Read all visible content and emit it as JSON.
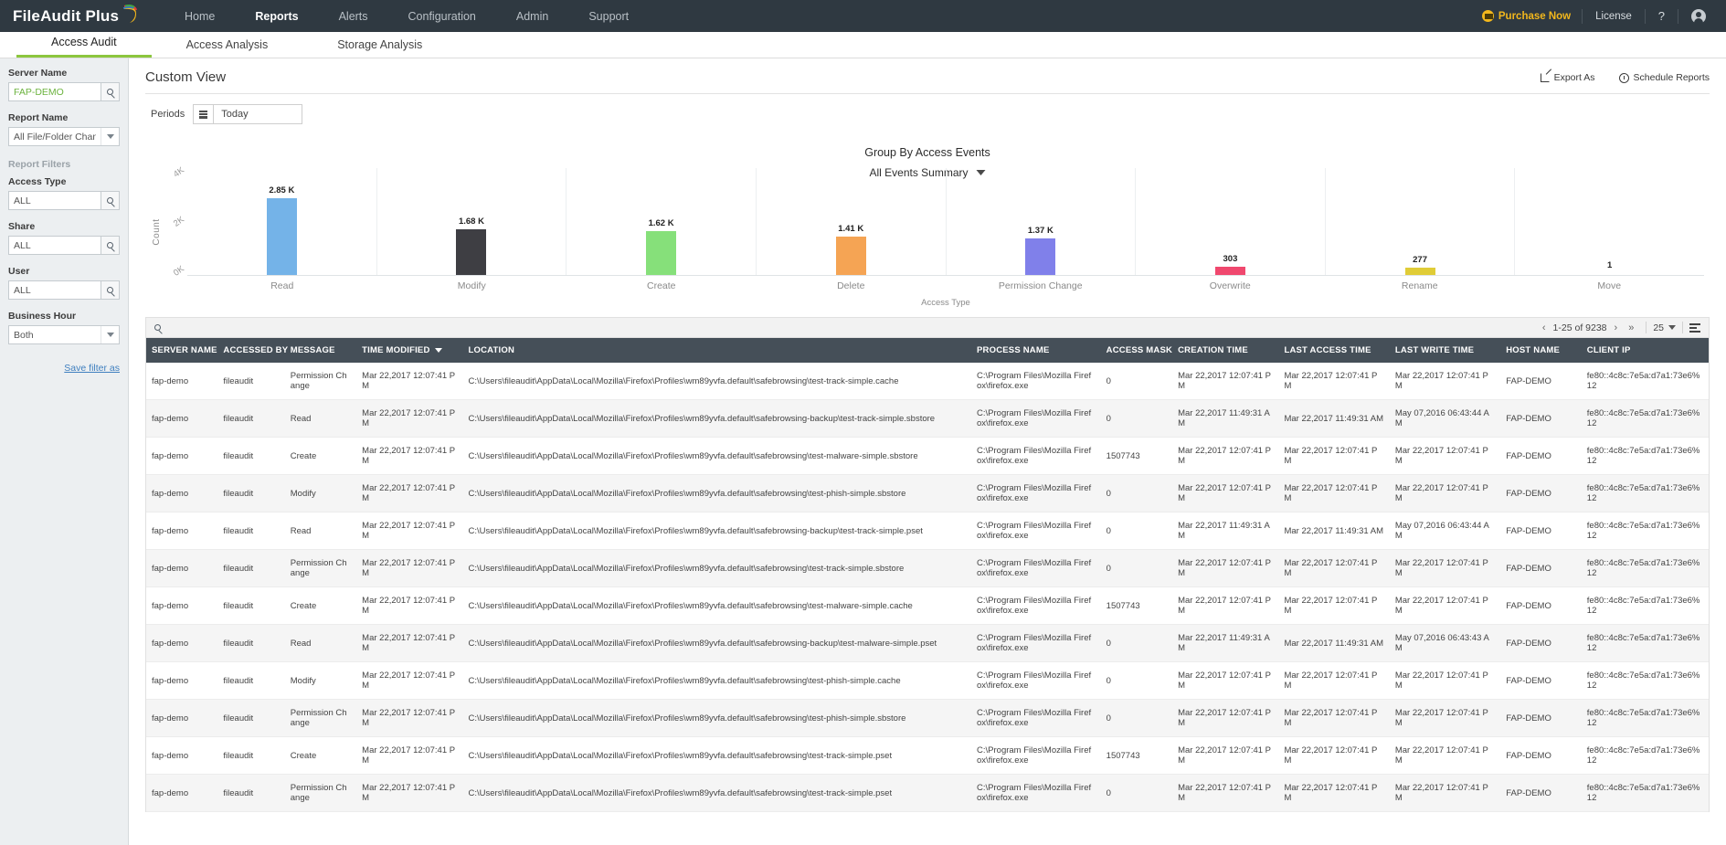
{
  "header": {
    "brand": "FileAudit Plus",
    "nav": [
      {
        "label": "Home",
        "active": false
      },
      {
        "label": "Reports",
        "active": true
      },
      {
        "label": "Alerts",
        "active": false
      },
      {
        "label": "Configuration",
        "active": false
      },
      {
        "label": "Admin",
        "active": false
      },
      {
        "label": "Support",
        "active": false
      }
    ],
    "purchase_label": "Purchase Now",
    "license_label": "License",
    "help_label": "?"
  },
  "subnav": [
    {
      "label": "Access Audit",
      "active": true
    },
    {
      "label": "Access Analysis",
      "active": false
    },
    {
      "label": "Storage Analysis",
      "active": false
    }
  ],
  "sidebar": {
    "server_name_label": "Server Name",
    "server_name_value": "FAP-DEMO",
    "report_name_label": "Report Name",
    "report_name_value": "All File/Folder Changes",
    "report_filters_label": "Report Filters",
    "access_type_label": "Access Type",
    "access_type_value": "ALL",
    "share_label": "Share",
    "share_value": "ALL",
    "user_label": "User",
    "user_value": "ALL",
    "business_hour_label": "Business Hour",
    "business_hour_value": "Both",
    "save_filter_label": "Save filter as"
  },
  "main": {
    "page_title": "Custom View",
    "export_label": "Export As",
    "schedule_label": "Schedule Reports",
    "periods_label": "Periods",
    "periods_value": "Today",
    "summary_label": "All Events Summary"
  },
  "chart_data": {
    "type": "bar",
    "title": "Group By Access Events",
    "xlabel": "Access Type",
    "ylabel": "Count",
    "ylim": [
      0,
      4000
    ],
    "ytick_labels": [
      "0K",
      "2K",
      "4K"
    ],
    "ytick_values": [
      0,
      2000,
      4000
    ],
    "grid": false,
    "legend": "none",
    "categories": [
      "Read",
      "Modify",
      "Create",
      "Delete",
      "Permission Change",
      "Overwrite",
      "Rename",
      "Move"
    ],
    "values": [
      2850,
      1680,
      1620,
      1410,
      1370,
      303,
      277,
      1
    ],
    "value_labels": [
      "2.85 K",
      "1.68 K",
      "1.62 K",
      "1.41 K",
      "1.37 K",
      "303",
      "277",
      "1"
    ],
    "colors": [
      "#74b3e8",
      "#3e3e43",
      "#86e07a",
      "#f5a454",
      "#8080ea",
      "#f0486e",
      "#e0cc37",
      "#ffffff"
    ]
  },
  "table": {
    "search_placeholder": "",
    "pager_text": "1-25 of 9238",
    "page_size": "25",
    "columns": [
      "SERVER NAME",
      "ACCESSED BY",
      "MESSAGE",
      "TIME MODIFIED",
      "LOCATION",
      "PROCESS NAME",
      "ACCESS MASK",
      "CREATION TIME",
      "LAST ACCESS TIME",
      "LAST WRITE TIME",
      "HOST NAME",
      "CLIENT IP"
    ],
    "sorted_column": "TIME MODIFIED",
    "rows": [
      {
        "server": "fap-demo",
        "accessed_by": "fileaudit",
        "message": "Permission Change",
        "time_modified": "Mar 22,2017 12:07:41 PM",
        "location": "C:\\Users\\fileaudit\\AppData\\Local\\Mozilla\\Firefox\\Profiles\\wm89yvfa.default\\safebrowsing\\test-track-simple.cache",
        "process": "C:\\Program Files\\Mozilla Firefox\\firefox.exe",
        "mask": "0",
        "creation": "Mar 22,2017 12:07:41 PM",
        "last_access": "Mar 22,2017 12:07:41 PM",
        "last_write": "Mar 22,2017 12:07:41 PM",
        "host": "FAP-DEMO",
        "client_ip": "fe80::4c8c:7e5a:d7a1:73e6%12"
      },
      {
        "server": "fap-demo",
        "accessed_by": "fileaudit",
        "message": "Read",
        "time_modified": "Mar 22,2017 12:07:41 PM",
        "location": "C:\\Users\\fileaudit\\AppData\\Local\\Mozilla\\Firefox\\Profiles\\wm89yvfa.default\\safebrowsing-backup\\test-track-simple.sbstore",
        "process": "C:\\Program Files\\Mozilla Firefox\\firefox.exe",
        "mask": "0",
        "creation": "Mar 22,2017 11:49:31 AM",
        "last_access": "Mar 22,2017 11:49:31 AM",
        "last_write": "May 07,2016 06:43:44 AM",
        "host": "FAP-DEMO",
        "client_ip": "fe80::4c8c:7e5a:d7a1:73e6%12"
      },
      {
        "server": "fap-demo",
        "accessed_by": "fileaudit",
        "message": "Create",
        "time_modified": "Mar 22,2017 12:07:41 PM",
        "location": "C:\\Users\\fileaudit\\AppData\\Local\\Mozilla\\Firefox\\Profiles\\wm89yvfa.default\\safebrowsing\\test-malware-simple.sbstore",
        "process": "C:\\Program Files\\Mozilla Firefox\\firefox.exe",
        "mask": "1507743",
        "creation": "Mar 22,2017 12:07:41 PM",
        "last_access": "Mar 22,2017 12:07:41 PM",
        "last_write": "Mar 22,2017 12:07:41 PM",
        "host": "FAP-DEMO",
        "client_ip": "fe80::4c8c:7e5a:d7a1:73e6%12"
      },
      {
        "server": "fap-demo",
        "accessed_by": "fileaudit",
        "message": "Modify",
        "time_modified": "Mar 22,2017 12:07:41 PM",
        "location": "C:\\Users\\fileaudit\\AppData\\Local\\Mozilla\\Firefox\\Profiles\\wm89yvfa.default\\safebrowsing\\test-phish-simple.sbstore",
        "process": "C:\\Program Files\\Mozilla Firefox\\firefox.exe",
        "mask": "0",
        "creation": "Mar 22,2017 12:07:41 PM",
        "last_access": "Mar 22,2017 12:07:41 PM",
        "last_write": "Mar 22,2017 12:07:41 PM",
        "host": "FAP-DEMO",
        "client_ip": "fe80::4c8c:7e5a:d7a1:73e6%12"
      },
      {
        "server": "fap-demo",
        "accessed_by": "fileaudit",
        "message": "Read",
        "time_modified": "Mar 22,2017 12:07:41 PM",
        "location": "C:\\Users\\fileaudit\\AppData\\Local\\Mozilla\\Firefox\\Profiles\\wm89yvfa.default\\safebrowsing-backup\\test-track-simple.pset",
        "process": "C:\\Program Files\\Mozilla Firefox\\firefox.exe",
        "mask": "0",
        "creation": "Mar 22,2017 11:49:31 AM",
        "last_access": "Mar 22,2017 11:49:31 AM",
        "last_write": "May 07,2016 06:43:44 AM",
        "host": "FAP-DEMO",
        "client_ip": "fe80::4c8c:7e5a:d7a1:73e6%12"
      },
      {
        "server": "fap-demo",
        "accessed_by": "fileaudit",
        "message": "Permission Change",
        "time_modified": "Mar 22,2017 12:07:41 PM",
        "location": "C:\\Users\\fileaudit\\AppData\\Local\\Mozilla\\Firefox\\Profiles\\wm89yvfa.default\\safebrowsing\\test-track-simple.sbstore",
        "process": "C:\\Program Files\\Mozilla Firefox\\firefox.exe",
        "mask": "0",
        "creation": "Mar 22,2017 12:07:41 PM",
        "last_access": "Mar 22,2017 12:07:41 PM",
        "last_write": "Mar 22,2017 12:07:41 PM",
        "host": "FAP-DEMO",
        "client_ip": "fe80::4c8c:7e5a:d7a1:73e6%12"
      },
      {
        "server": "fap-demo",
        "accessed_by": "fileaudit",
        "message": "Create",
        "time_modified": "Mar 22,2017 12:07:41 PM",
        "location": "C:\\Users\\fileaudit\\AppData\\Local\\Mozilla\\Firefox\\Profiles\\wm89yvfa.default\\safebrowsing\\test-malware-simple.cache",
        "process": "C:\\Program Files\\Mozilla Firefox\\firefox.exe",
        "mask": "1507743",
        "creation": "Mar 22,2017 12:07:41 PM",
        "last_access": "Mar 22,2017 12:07:41 PM",
        "last_write": "Mar 22,2017 12:07:41 PM",
        "host": "FAP-DEMO",
        "client_ip": "fe80::4c8c:7e5a:d7a1:73e6%12"
      },
      {
        "server": "fap-demo",
        "accessed_by": "fileaudit",
        "message": "Read",
        "time_modified": "Mar 22,2017 12:07:41 PM",
        "location": "C:\\Users\\fileaudit\\AppData\\Local\\Mozilla\\Firefox\\Profiles\\wm89yvfa.default\\safebrowsing-backup\\test-malware-simple.pset",
        "process": "C:\\Program Files\\Mozilla Firefox\\firefox.exe",
        "mask": "0",
        "creation": "Mar 22,2017 11:49:31 AM",
        "last_access": "Mar 22,2017 11:49:31 AM",
        "last_write": "May 07,2016 06:43:43 AM",
        "host": "FAP-DEMO",
        "client_ip": "fe80::4c8c:7e5a:d7a1:73e6%12"
      },
      {
        "server": "fap-demo",
        "accessed_by": "fileaudit",
        "message": "Modify",
        "time_modified": "Mar 22,2017 12:07:41 PM",
        "location": "C:\\Users\\fileaudit\\AppData\\Local\\Mozilla\\Firefox\\Profiles\\wm89yvfa.default\\safebrowsing\\test-phish-simple.cache",
        "process": "C:\\Program Files\\Mozilla Firefox\\firefox.exe",
        "mask": "0",
        "creation": "Mar 22,2017 12:07:41 PM",
        "last_access": "Mar 22,2017 12:07:41 PM",
        "last_write": "Mar 22,2017 12:07:41 PM",
        "host": "FAP-DEMO",
        "client_ip": "fe80::4c8c:7e5a:d7a1:73e6%12"
      },
      {
        "server": "fap-demo",
        "accessed_by": "fileaudit",
        "message": "Permission Change",
        "time_modified": "Mar 22,2017 12:07:41 PM",
        "location": "C:\\Users\\fileaudit\\AppData\\Local\\Mozilla\\Firefox\\Profiles\\wm89yvfa.default\\safebrowsing\\test-phish-simple.sbstore",
        "process": "C:\\Program Files\\Mozilla Firefox\\firefox.exe",
        "mask": "0",
        "creation": "Mar 22,2017 12:07:41 PM",
        "last_access": "Mar 22,2017 12:07:41 PM",
        "last_write": "Mar 22,2017 12:07:41 PM",
        "host": "FAP-DEMO",
        "client_ip": "fe80::4c8c:7e5a:d7a1:73e6%12"
      },
      {
        "server": "fap-demo",
        "accessed_by": "fileaudit",
        "message": "Create",
        "time_modified": "Mar 22,2017 12:07:41 PM",
        "location": "C:\\Users\\fileaudit\\AppData\\Local\\Mozilla\\Firefox\\Profiles\\wm89yvfa.default\\safebrowsing\\test-track-simple.pset",
        "process": "C:\\Program Files\\Mozilla Firefox\\firefox.exe",
        "mask": "1507743",
        "creation": "Mar 22,2017 12:07:41 PM",
        "last_access": "Mar 22,2017 12:07:41 PM",
        "last_write": "Mar 22,2017 12:07:41 PM",
        "host": "FAP-DEMO",
        "client_ip": "fe80::4c8c:7e5a:d7a1:73e6%12"
      },
      {
        "server": "fap-demo",
        "accessed_by": "fileaudit",
        "message": "Permission Change",
        "time_modified": "Mar 22,2017 12:07:41 PM",
        "location": "C:\\Users\\fileaudit\\AppData\\Local\\Mozilla\\Firefox\\Profiles\\wm89yvfa.default\\safebrowsing\\test-track-simple.pset",
        "process": "C:\\Program Files\\Mozilla Firefox\\firefox.exe",
        "mask": "0",
        "creation": "Mar 22,2017 12:07:41 PM",
        "last_access": "Mar 22,2017 12:07:41 PM",
        "last_write": "Mar 22,2017 12:07:41 PM",
        "host": "FAP-DEMO",
        "client_ip": "fe80::4c8c:7e5a:d7a1:73e6%12"
      }
    ]
  }
}
